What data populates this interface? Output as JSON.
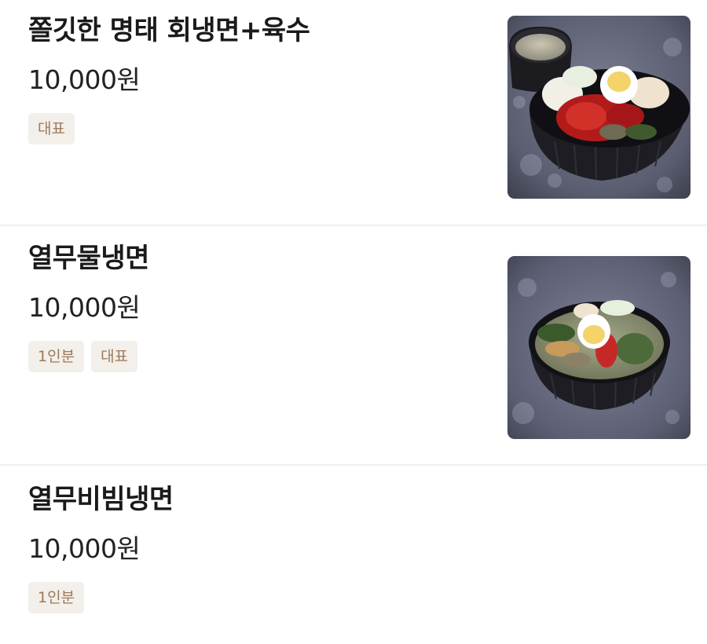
{
  "menu": {
    "items": [
      {
        "name": "쫄깃한 명태 회냉면+육수",
        "price": "10,000원",
        "tags": [
          "대표"
        ],
        "image": "bibim-naengmyeon-with-broth-photo"
      },
      {
        "name": "열무물냉면",
        "price": "10,000원",
        "tags": [
          "1인분",
          "대표"
        ],
        "image": "mul-naengmyeon-photo"
      },
      {
        "name": "열무비빔냉면",
        "price": "10,000원",
        "tags": [
          "1인분"
        ]
      }
    ]
  },
  "colors": {
    "tag_background": "#f3efea",
    "tag_text": "#9b7a5a",
    "divider": "#efefef"
  }
}
